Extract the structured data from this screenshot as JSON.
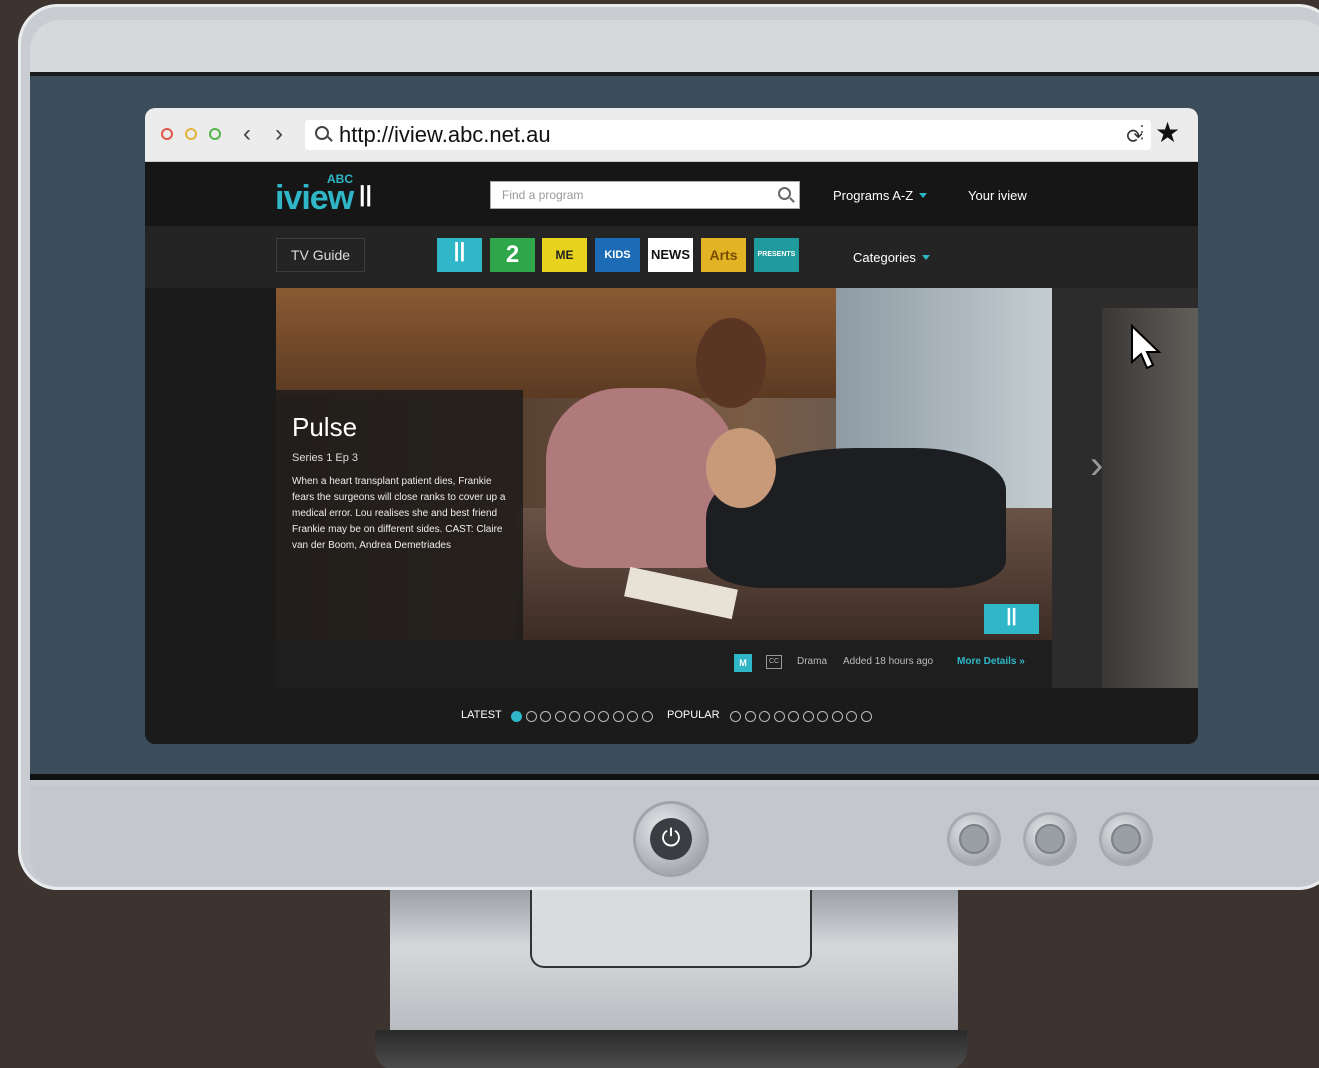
{
  "browser": {
    "url": "http://iview.abc.net.au"
  },
  "site": {
    "logo_top": "ABC",
    "logo_main": "iview",
    "search_placeholder": "Find a program",
    "nav_programs": "Programs A-Z",
    "nav_your_iview": "Your iview",
    "tv_guide": "TV Guide",
    "categories": "Categories",
    "channels": [
      {
        "name": "ABC",
        "label": "ꟾꟾ",
        "bg": "#2fb7c8",
        "fg": "#ffffff"
      },
      {
        "name": "ABC2",
        "label": "2",
        "bg": "#2fa64a",
        "fg": "#ffffff"
      },
      {
        "name": "ABC ME",
        "label": "ME",
        "bg": "#e7d21d",
        "fg": "#222222"
      },
      {
        "name": "ABC KIDS",
        "label": "KIDS",
        "bg": "#1c6bb5",
        "fg": "#ffffff"
      },
      {
        "name": "NEWS",
        "label": "NEWS",
        "bg": "#ffffff",
        "fg": "#111111"
      },
      {
        "name": "Arts",
        "label": "Arts",
        "bg": "#e2b324",
        "fg": "#7a4b00"
      },
      {
        "name": "ABC Presents",
        "label": "PRESENTS",
        "bg": "#1f9a9d",
        "fg": "#ffffff"
      }
    ]
  },
  "hero": {
    "title": "Pulse",
    "episode": "Series 1 Ep 3",
    "description": "When a heart transplant patient dies, Frankie fears the surgeons will close ranks to cover up a medical error. Lou realises she and best friend Frankie may be on different sides. CAST: Claire van der Boom, Andrea Demetriades",
    "rating": "M",
    "cc": "CC",
    "genre": "Drama",
    "added": "Added 18 hours ago",
    "more_details": "More Details »"
  },
  "carousel": {
    "latest_label": "LATEST",
    "popular_label": "POPULAR",
    "latest_count": 10,
    "popular_count": 10,
    "active_index": 0
  },
  "colors": {
    "accent": "#2fb7c8",
    "screen_bg": "#3b4c5a",
    "monitor": "#c9ccd0"
  }
}
